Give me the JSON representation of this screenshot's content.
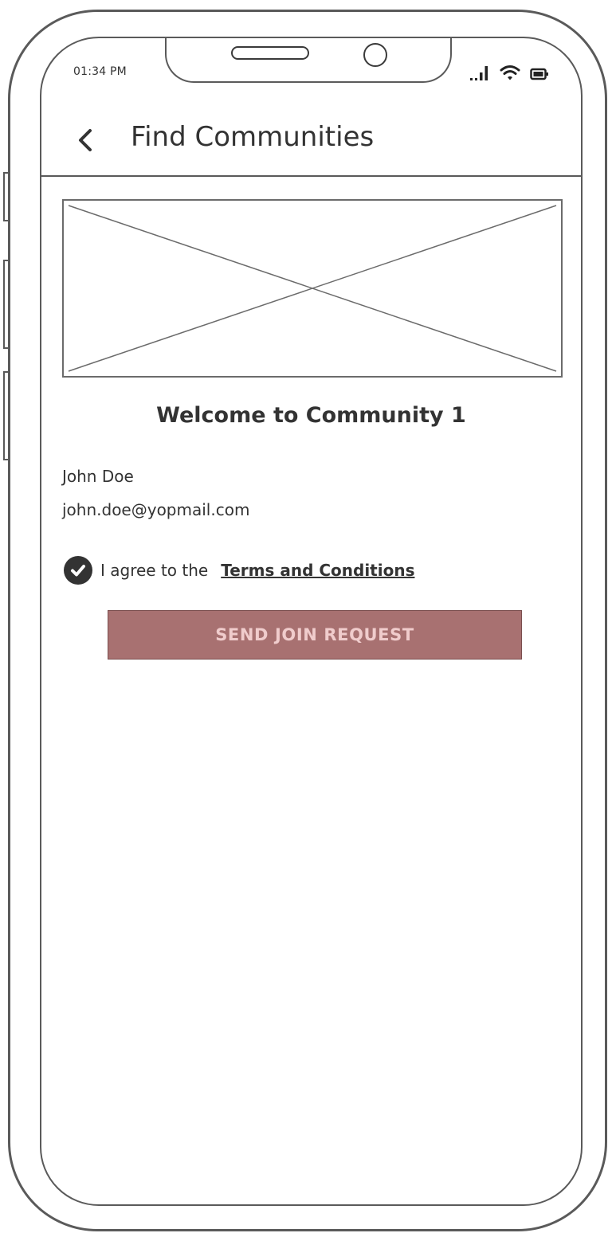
{
  "status_bar": {
    "time": "01:34 PM",
    "icons": [
      "signal-icon",
      "wifi-icon",
      "battery-icon"
    ]
  },
  "header": {
    "back_icon": "chevron-left-icon",
    "title": "Find Communities"
  },
  "community": {
    "image": "placeholder-image",
    "welcome_text": "Welcome to Community 1"
  },
  "user": {
    "name": "John Doe",
    "email": "john.doe@yopmail.com"
  },
  "agreement": {
    "checked": true,
    "text": "I agree to the",
    "link_text": "Terms and Conditions"
  },
  "actions": {
    "join_label": "SEND JOIN REQUEST"
  },
  "colors": {
    "button_bg": "#a87171",
    "button_text": "#f0cccc",
    "outline": "#5a5a5a",
    "text": "#333333"
  }
}
